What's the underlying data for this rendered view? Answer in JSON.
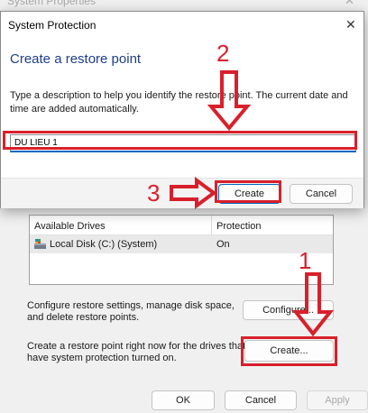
{
  "background": {
    "title": "System Properties",
    "close_glyph": "✕",
    "drives": {
      "header": [
        "Available Drives",
        "Protection"
      ],
      "rows": [
        {
          "name": "Local Disk (C:) (System)",
          "protection": "On"
        }
      ]
    },
    "configure_text": [
      "Configure restore settings, manage disk space,",
      "and delete restore points."
    ],
    "configure_label": "Configure...",
    "create_text": [
      "Create a restore point right now for the drives that",
      "have system protection turned on."
    ],
    "create_label": "Create...",
    "ok_label": "OK",
    "cancel_label": "Cancel",
    "apply_label": "Apply"
  },
  "dialog": {
    "title": "System Protection",
    "close_glyph": "✕",
    "heading": "Create a restore point",
    "description": "Type a description to help you identify the restore point. The current date and time are added automatically.",
    "input_value": "DU LIEU 1",
    "create_label": "Create",
    "cancel_label": "Cancel"
  },
  "annotations": {
    "labels": [
      "1",
      "2",
      "3"
    ],
    "color": "#d8202b"
  },
  "colors": {
    "heading_blue": "#1c3f8a",
    "accent_blue": "#0067c0",
    "annotation_red": "#d8202b"
  }
}
